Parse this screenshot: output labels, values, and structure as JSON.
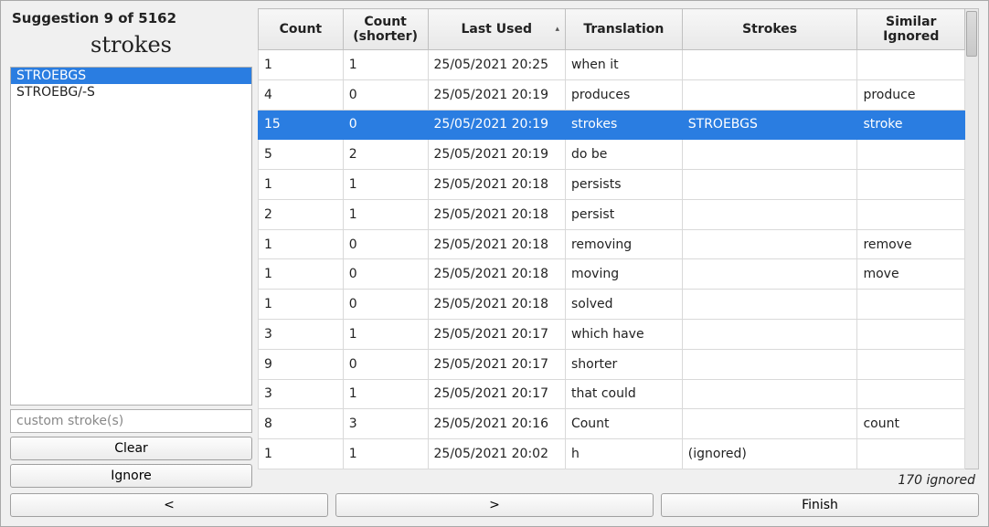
{
  "header": {
    "suggestion_label": "Suggestion 9 of 5162",
    "translation_word": "strokes"
  },
  "stroke_list": {
    "items": [
      "STROEBGS",
      "STROEBG/-S"
    ],
    "selected_index": 0
  },
  "custom_stroke": {
    "placeholder": "custom stroke(s)",
    "value": ""
  },
  "buttons": {
    "clear": "Clear",
    "ignore": "Ignore",
    "prev": "<",
    "next": ">",
    "finish": "Finish"
  },
  "table": {
    "headers": {
      "count": "Count",
      "count_shorter": "Count (shorter)",
      "last_used": "Last Used",
      "translation": "Translation",
      "strokes": "Strokes",
      "similar_ignored": "Similar Ignored"
    },
    "sort_column": "last_used",
    "sort_dir": "asc",
    "selected_index": 2,
    "rows": [
      {
        "count": "1",
        "shorter": "1",
        "last": "25/05/2021 20:25",
        "translation": "when it",
        "strokes": "",
        "similar": ""
      },
      {
        "count": "4",
        "shorter": "0",
        "last": "25/05/2021 20:19",
        "translation": "produces",
        "strokes": "",
        "similar": "produce"
      },
      {
        "count": "15",
        "shorter": "0",
        "last": "25/05/2021 20:19",
        "translation": "strokes",
        "strokes": "STROEBGS",
        "similar": "stroke"
      },
      {
        "count": "5",
        "shorter": "2",
        "last": "25/05/2021 20:19",
        "translation": "do be",
        "strokes": "",
        "similar": ""
      },
      {
        "count": "1",
        "shorter": "1",
        "last": "25/05/2021 20:18",
        "translation": "persists",
        "strokes": "",
        "similar": ""
      },
      {
        "count": "2",
        "shorter": "1",
        "last": "25/05/2021 20:18",
        "translation": "persist",
        "strokes": "",
        "similar": ""
      },
      {
        "count": "1",
        "shorter": "0",
        "last": "25/05/2021 20:18",
        "translation": "removing",
        "strokes": "",
        "similar": "remove"
      },
      {
        "count": "1",
        "shorter": "0",
        "last": "25/05/2021 20:18",
        "translation": "moving",
        "strokes": "",
        "similar": "move"
      },
      {
        "count": "1",
        "shorter": "0",
        "last": "25/05/2021 20:18",
        "translation": "solved",
        "strokes": "",
        "similar": ""
      },
      {
        "count": "3",
        "shorter": "1",
        "last": "25/05/2021 20:17",
        "translation": "which have",
        "strokes": "",
        "similar": ""
      },
      {
        "count": "9",
        "shorter": "0",
        "last": "25/05/2021 20:17",
        "translation": "shorter",
        "strokes": "",
        "similar": ""
      },
      {
        "count": "3",
        "shorter": "1",
        "last": "25/05/2021 20:17",
        "translation": "that could",
        "strokes": "",
        "similar": ""
      },
      {
        "count": "8",
        "shorter": "3",
        "last": "25/05/2021 20:16",
        "translation": "Count",
        "strokes": "",
        "similar": "count"
      },
      {
        "count": "1",
        "shorter": "1",
        "last": "25/05/2021 20:02",
        "translation": "h",
        "strokes": "(ignored)",
        "similar": ""
      }
    ]
  },
  "footer": {
    "ignored_text": "170 ignored"
  }
}
